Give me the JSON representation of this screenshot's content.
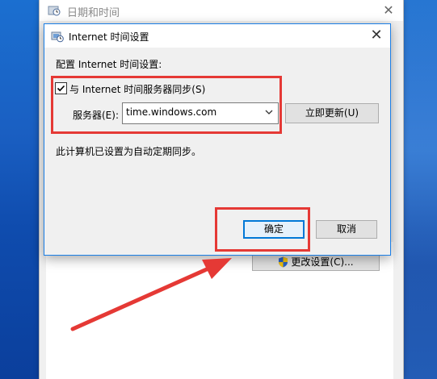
{
  "back_window": {
    "title": "日期和时间",
    "change_settings_label": "更改设置(C)..."
  },
  "dialog": {
    "title": "Internet 时间设置",
    "config_label": "配置 Internet 时间设置:",
    "sync_label": "与 Internet 时间服务器同步(S)",
    "sync_checked": true,
    "server_label": "服务器(E):",
    "server_value": "time.windows.com",
    "update_now_label": "立即更新(U)",
    "status_text": "此计算机已设置为自动定期同步。",
    "ok_label": "确定",
    "cancel_label": "取消"
  },
  "icons": {
    "dialog_icon": "clock-network-icon",
    "close": "close-icon",
    "dropdown": "chevron-down-icon",
    "shield": "uac-shield-icon",
    "annotation_arrow": "red-arrow-icon"
  },
  "colors": {
    "annotation": "#e53935",
    "accent": "#0078d7",
    "desktop": "#1a5fc2"
  }
}
